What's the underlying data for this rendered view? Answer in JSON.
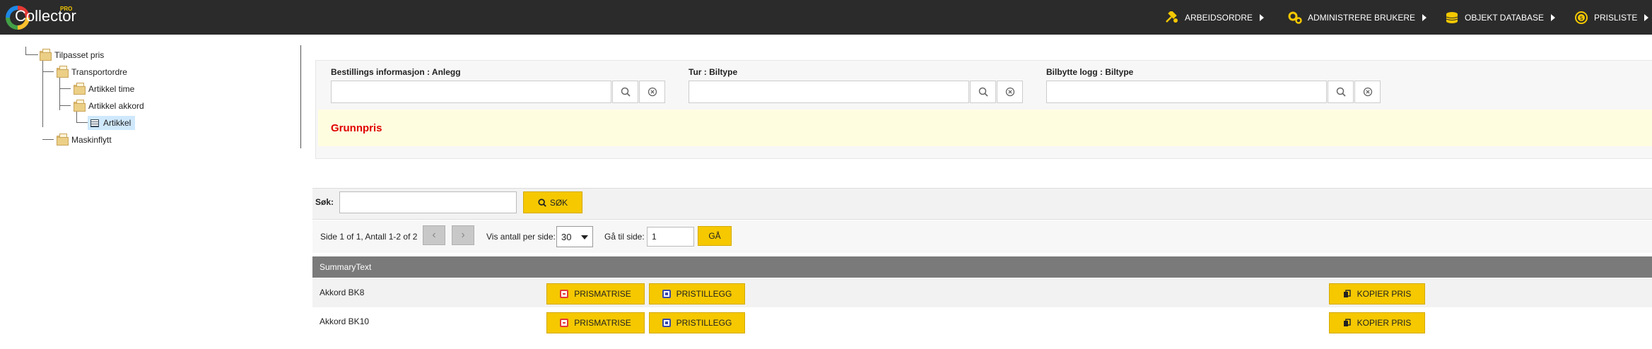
{
  "app": {
    "logo_text": "Collector",
    "logo_badge": "PRO"
  },
  "nav": [
    {
      "label": "ARBEIDSORDRE",
      "icon": "wrench-hammer-icon"
    },
    {
      "label": "ADMINISTRERE BRUKERE",
      "icon": "gears-icon"
    },
    {
      "label": "OBJEKT DATABASE",
      "icon": "coins-stack-icon"
    },
    {
      "label": "PRISLISTE",
      "icon": "dollar-coin-icon"
    }
  ],
  "tree": {
    "root": "Tilpasset pris",
    "transportordre": "Transportordre",
    "artikkel_time": "Artikkel time",
    "artikkel_akkord": "Artikkel akkord",
    "artikkel": "Artikkel",
    "maskinflytt": "Maskinflytt"
  },
  "filters": [
    {
      "label": "Bestillings informasjon : Anlegg",
      "value": ""
    },
    {
      "label": "Tur : Biltype",
      "value": ""
    },
    {
      "label": "Bilbytte logg : Biltype",
      "value": ""
    }
  ],
  "band": {
    "title": "Grunnpris"
  },
  "search": {
    "label": "Søk:",
    "value": "",
    "button": "SØK"
  },
  "pager": {
    "summary": "Side 1 of 1, Antall 1-2 of 2",
    "per_page_label": "Vis antall per side:",
    "per_page_value": "30",
    "goto_label": "Gå til side:",
    "goto_value": "1",
    "goto_button": "GÅ"
  },
  "table": {
    "header": "SummaryText",
    "rows": [
      {
        "summary": "Akkord BK8",
        "btn1": "PRISMATRISE",
        "btn2": "PRISTILLEGG",
        "btn3": "KOPIER PRIS"
      },
      {
        "summary": "Akkord BK10",
        "btn1": "PRISMATRISE",
        "btn2": "PRISTILLEGG",
        "btn3": "KOPIER PRIS"
      }
    ]
  },
  "colors": {
    "topbar": "#2b2b2b",
    "accent_yellow": "#f5c800",
    "grunnpris_red": "#e00000",
    "band_bg": "#fffde0",
    "table_header": "#7a7a7a"
  }
}
